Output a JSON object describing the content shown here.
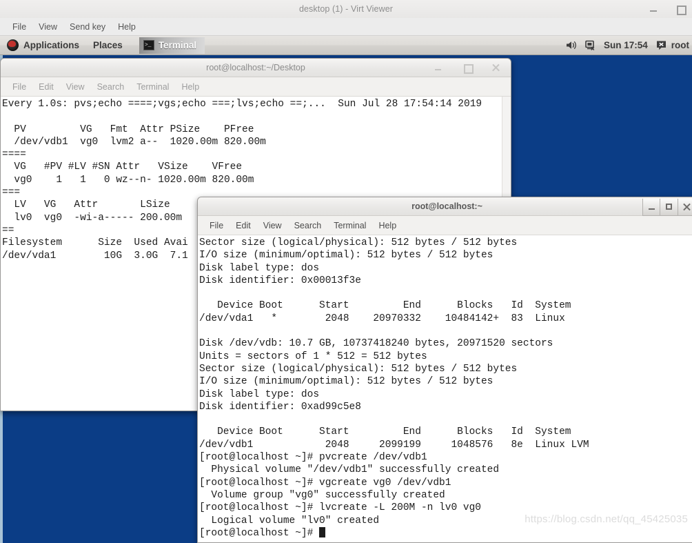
{
  "viewer": {
    "title": "desktop (1) - Virt Viewer",
    "menu": [
      "File",
      "View",
      "Send key",
      "Help"
    ],
    "window_buttons": [
      {
        "name": "minimize",
        "glyph": "minimize-icon"
      },
      {
        "name": "maximize",
        "glyph": "maximize-icon"
      }
    ]
  },
  "panel": {
    "applications_label": "Applications",
    "places_label": "Places",
    "task_label": "Terminal",
    "task_icon": "terminal-icon",
    "logo_icon": "fedora-logo-icon",
    "volume_icon": "volume-icon",
    "network_icon": "network-disconnected-icon",
    "clock": "Sun 17:54",
    "user_icon": "user-status-icon",
    "user_label": "root"
  },
  "desktop": {
    "background_color": "#0b3d86",
    "watermark": "https://blog.csdn.net/qq_45425035"
  },
  "terminal1": {
    "title": "root@localhost:~/Desktop",
    "menu": [
      "File",
      "Edit",
      "View",
      "Search",
      "Terminal",
      "Help"
    ],
    "window_buttons": [
      "minimize-icon",
      "maximize-icon",
      "close-icon"
    ],
    "lines": [
      "Every 1.0s: pvs;echo ====;vgs;echo ===;lvs;echo ==;...  Sun Jul 28 17:54:14 2019",
      "",
      "  PV         VG   Fmt  Attr PSize    PFree",
      "  /dev/vdb1  vg0  lvm2 a--  1020.00m 820.00m",
      "====",
      "  VG   #PV #LV #SN Attr   VSize    VFree",
      "  vg0    1   1   0 wz--n- 1020.00m 820.00m",
      "===",
      "  LV   VG   Attr       LSize",
      "  lv0  vg0  -wi-a----- 200.00m",
      "==",
      "Filesystem      Size  Used Avai",
      "/dev/vda1        10G  3.0G  7.1"
    ]
  },
  "terminal2": {
    "title": "root@localhost:~",
    "menu": [
      "File",
      "Edit",
      "View",
      "Search",
      "Terminal",
      "Help"
    ],
    "window_buttons": [
      "minimize-icon",
      "maximize-icon",
      "close-icon"
    ],
    "lines": [
      "Sector size (logical/physical): 512 bytes / 512 bytes",
      "I/O size (minimum/optimal): 512 bytes / 512 bytes",
      "Disk label type: dos",
      "Disk identifier: 0x00013f3e",
      "",
      "   Device Boot      Start         End      Blocks   Id  System",
      "/dev/vda1   *        2048    20970332    10484142+  83  Linux",
      "",
      "Disk /dev/vdb: 10.7 GB, 10737418240 bytes, 20971520 sectors",
      "Units = sectors of 1 * 512 = 512 bytes",
      "Sector size (logical/physical): 512 bytes / 512 bytes",
      "I/O size (minimum/optimal): 512 bytes / 512 bytes",
      "Disk label type: dos",
      "Disk identifier: 0xad99c5e8",
      "",
      "   Device Boot      Start         End      Blocks   Id  System",
      "/dev/vdb1            2048     2099199     1048576   8e  Linux LVM",
      "[root@localhost ~]# pvcreate /dev/vdb1",
      "  Physical volume \"/dev/vdb1\" successfully created",
      "[root@localhost ~]# vgcreate vg0 /dev/vdb1",
      "  Volume group \"vg0\" successfully created",
      "[root@localhost ~]# lvcreate -L 200M -n lv0 vg0",
      "  Logical volume \"lv0\" created"
    ],
    "prompt": "[root@localhost ~]# "
  }
}
